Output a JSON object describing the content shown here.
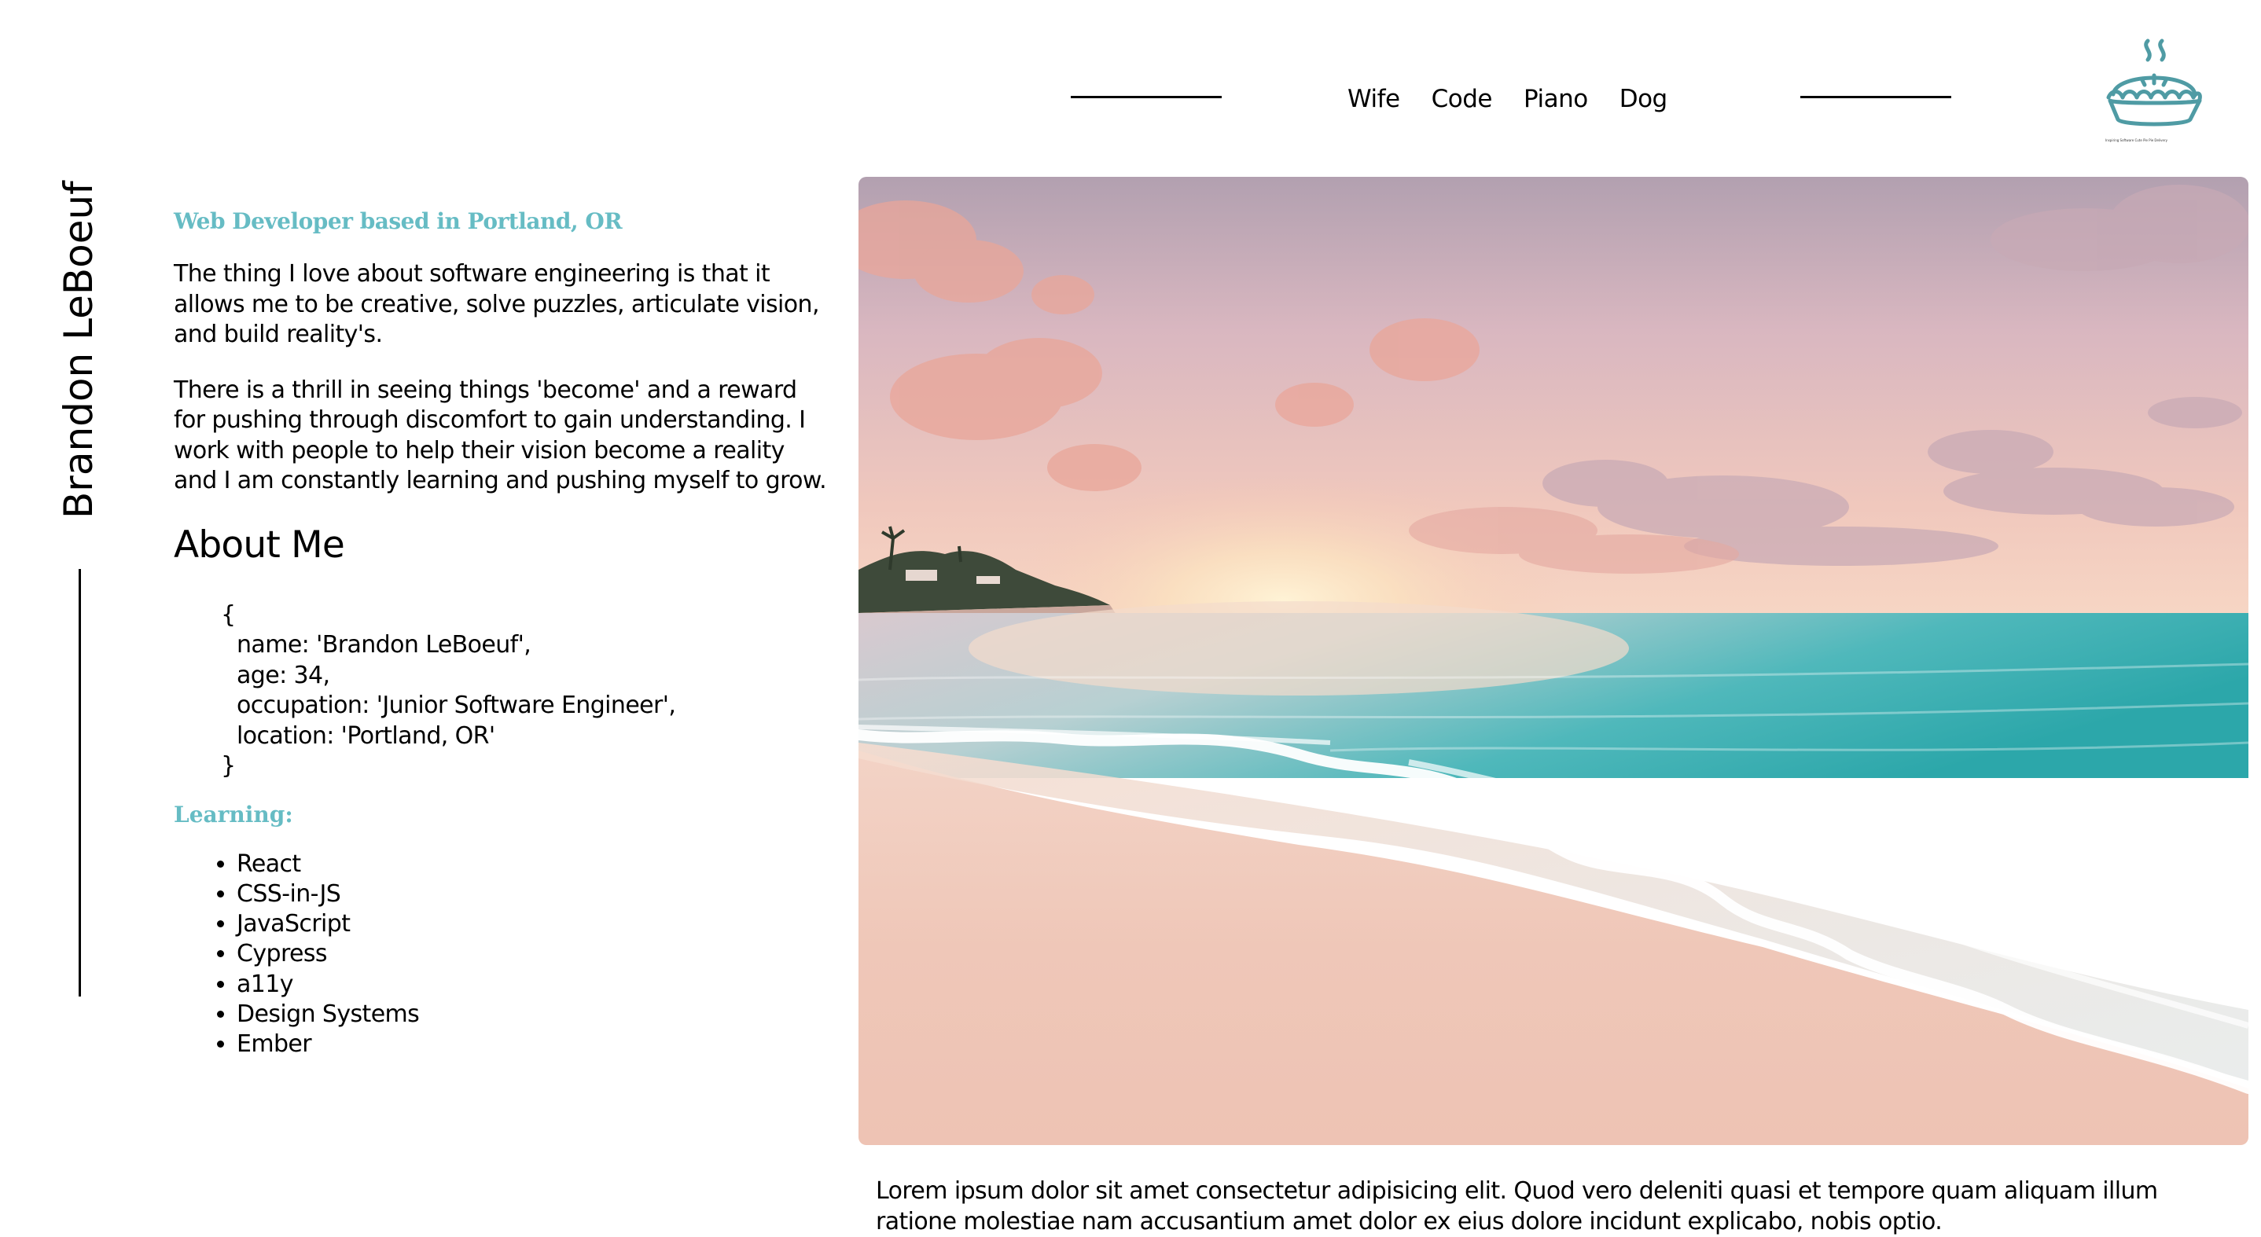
{
  "nav": {
    "links": [
      {
        "label": "Wife"
      },
      {
        "label": "Code"
      },
      {
        "label": "Piano"
      },
      {
        "label": "Dog"
      }
    ]
  },
  "logo": {
    "icon": "pie-icon",
    "color": "#4f9ba4",
    "caption": "Inspiring Software Cute Pie Pie Delivery"
  },
  "sidebar": {
    "name": "Brandon LeBoeuf"
  },
  "intro": {
    "tagline": "Web Developer based in Portland, OR",
    "paragraph1": "The thing I love about software engineering is that it allows me to be creative, solve puzzles, articulate vision, and build reality's.",
    "paragraph2": "There is a thrill in seeing things 'become' and a reward for pushing through discomfort to gain understanding. I work with people to help their vision become a reality and I am constantly learning and pushing myself to grow."
  },
  "about": {
    "heading": "About Me",
    "open_brace": "{",
    "close_brace": "}",
    "lines": [
      "name: 'Brandon LeBoeuf',",
      "age: 34,",
      "occupation: 'Junior Software Engineer',",
      "location: 'Portland, OR'"
    ]
  },
  "learning": {
    "heading": "Learning:",
    "items": [
      "React",
      "CSS-in-JS",
      "JavaScript",
      "Cypress",
      "a11y",
      "Design Systems",
      "Ember"
    ]
  },
  "hero": {
    "image": "beach-sunset-image"
  },
  "caption": {
    "text": "Lorem ipsum dolor sit amet consectetur adipisicing elit. Quod vero deleniti quasi et tempore quam aliquam illum ratione molestiae nam accusantium amet dolor ex eius dolore incidunt explicabo, nobis optio."
  },
  "colors": {
    "accent": "#66bcc4",
    "text": "#000000",
    "background": "#ffffff"
  }
}
